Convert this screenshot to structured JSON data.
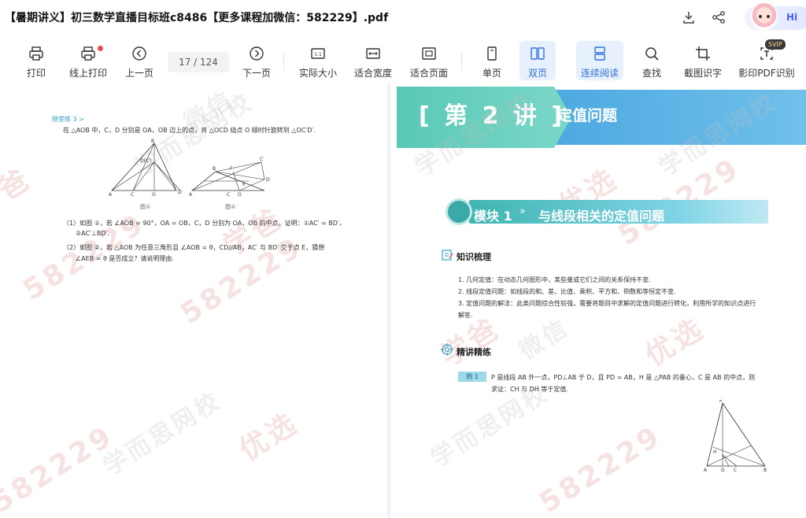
{
  "window": {
    "title": "【暑期讲义】初三数学直播目标班c8486【更多课程加微信：582229】.pdf",
    "greeting": "Hi"
  },
  "toolbar": {
    "items": [
      {
        "id": "print",
        "label": "打印",
        "icon": "printer-icon"
      },
      {
        "id": "online-print",
        "label": "线上打印",
        "icon": "online-printer-icon"
      },
      {
        "id": "prev",
        "label": "上一页",
        "icon": "chevron-left-icon"
      },
      {
        "id": "next",
        "label": "下一页",
        "icon": "chevron-right-icon"
      },
      {
        "id": "actual-size",
        "label": "实际大小",
        "icon": "one-to-one-icon"
      },
      {
        "id": "fit-width",
        "label": "适合宽度",
        "icon": "fit-width-icon"
      },
      {
        "id": "fit-page",
        "label": "适合页面",
        "icon": "fit-page-icon"
      },
      {
        "id": "single",
        "label": "单页",
        "icon": "single-page-icon"
      },
      {
        "id": "double",
        "label": "双页",
        "icon": "double-page-icon"
      },
      {
        "id": "continuous",
        "label": "连续阅读",
        "icon": "continuous-icon"
      },
      {
        "id": "find",
        "label": "查找",
        "icon": "search-icon"
      },
      {
        "id": "ocr",
        "label": "截图识字",
        "icon": "crop-icon"
      },
      {
        "id": "pdf-ocr",
        "label": "影印PDF识别",
        "icon": "pdf-recognize-icon"
      }
    ],
    "page_indicator": "17 / 124",
    "svip_badge": "SVIP",
    "active": [
      "double",
      "continuous"
    ]
  },
  "left_page": {
    "heading": "随堂练 3 >",
    "intro": "在 △AOB 中，C，D 分别是 OA，OB 边上的点，将 △OCD 绕点 O 顺时针旋转到 △OC′D′.",
    "fig1_caption": "图①",
    "fig2_caption": "图②",
    "q1_line1": "（1）如图 ①，若 ∠AOB = 90°，OA = OB，C，D 分别为 OA，OB 的中点，证明：①AC′ = BD′，",
    "q1_line2": "②AC′⊥BD′.",
    "q2_line1": "（2）如图 ②，若 △AOB 为任意三角形且 ∠AOB = θ，CD//AB，AC′ 与 BD′ 交于点 E，猜想",
    "q2_line2": "∠AEB = θ 是否成立？请说明理由."
  },
  "right_page": {
    "lecture_number": "[ 第 2 讲 ]",
    "lecture_title": "定值问题",
    "module_label": "模块 1",
    "module_arrow": "»",
    "module_title": "与线段相关的定值问题",
    "knowledge_heading": "知识梳理",
    "knowledge_items": [
      "1. 几何定值：在动态几何图形中，某些量或它们之间的关系保持不变.",
      "2. 线段定值问题：如线段的和、差、比值、乘积、平方和、倒数和等恒定不变.",
      "3. 定值问题的解法：此类问题综合性较强，需要将题目中求解的定值问题进行转化，利用所学的知识点进行",
      "   解答."
    ],
    "practice_heading": "精讲精练",
    "example_tag": "例 1",
    "example_line1": "P 是线段 AB 外一点，PD⊥AB 于 D，且 PD = AB，H 是 △PAB 的垂心，C 是 AB 的中点，则",
    "example_line2": "求证：CH 与 DH 等于定值."
  },
  "watermarks": [
    "学而思网校",
    "学爸",
    "优选",
    "582229",
    "微信"
  ]
}
